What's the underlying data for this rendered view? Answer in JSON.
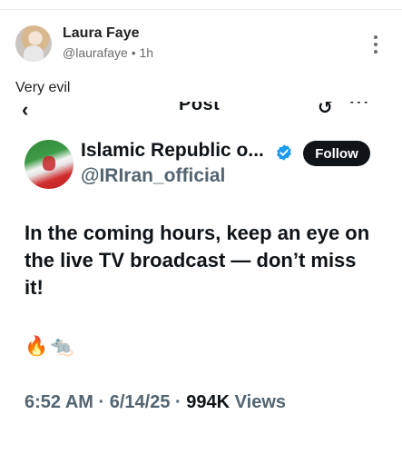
{
  "post": {
    "author_name": "Laura Faye",
    "author_handle": "@laurafaye",
    "separator": "•",
    "time_ago": "1h",
    "caption": "Very evil"
  },
  "embed": {
    "topbar": {
      "back_glyph": "‹",
      "title": "Post",
      "reply_glyph": "↺",
      "more_glyph": "···"
    },
    "tweet": {
      "display_name": "Islamic Republic o...",
      "handle": "@IRIran_official",
      "follow_label": "Follow",
      "text": "In the coming hours, keep an eye on the live TV broadcast — don’t miss it!",
      "emojis": "🔥🐀",
      "time": "6:52 AM",
      "dot1": "·",
      "date": "6/14/25",
      "dot2": "·",
      "views_count": "994K",
      "views_label": "Views"
    }
  },
  "colors": {
    "text_primary": "#0f1419",
    "text_secondary": "#536471",
    "verified_blue": "#1d9bf0"
  },
  "icons": [
    "kebab-menu-icon",
    "back-arrow-icon",
    "reply-icon",
    "more-icon",
    "verified-badge-icon"
  ]
}
